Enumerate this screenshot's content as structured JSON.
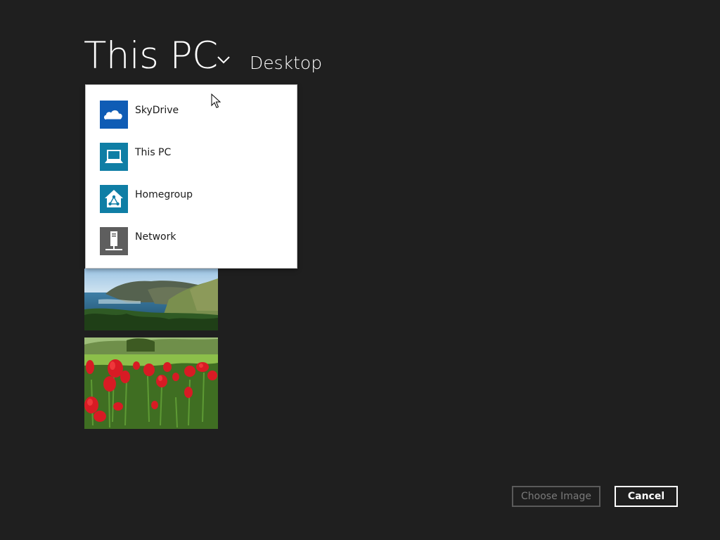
{
  "header": {
    "title": "This PC",
    "subtitle": "Desktop",
    "dropdown_icon": "chevron-down-icon"
  },
  "dropdown": {
    "items": [
      {
        "label": "SkyDrive",
        "icon": "cloud-icon",
        "color": "#0f5cb5"
      },
      {
        "label": "This PC",
        "icon": "laptop-icon",
        "color": "#0f7ea5"
      },
      {
        "label": "Homegroup",
        "icon": "homegroup-icon",
        "color": "#0f7ea5"
      },
      {
        "label": "Network",
        "icon": "network-icon",
        "color": "#5e5e5e"
      }
    ]
  },
  "thumbnails": [
    {
      "subject": "coastline-photo"
    },
    {
      "subject": "red-tulips-photo"
    }
  ],
  "buttons": {
    "choose_label": "Choose Image",
    "choose_enabled": false,
    "cancel_label": "Cancel"
  },
  "colors": {
    "background": "#1f1f1f",
    "text": "#ffffff",
    "disabled": "#7a7a7a"
  }
}
